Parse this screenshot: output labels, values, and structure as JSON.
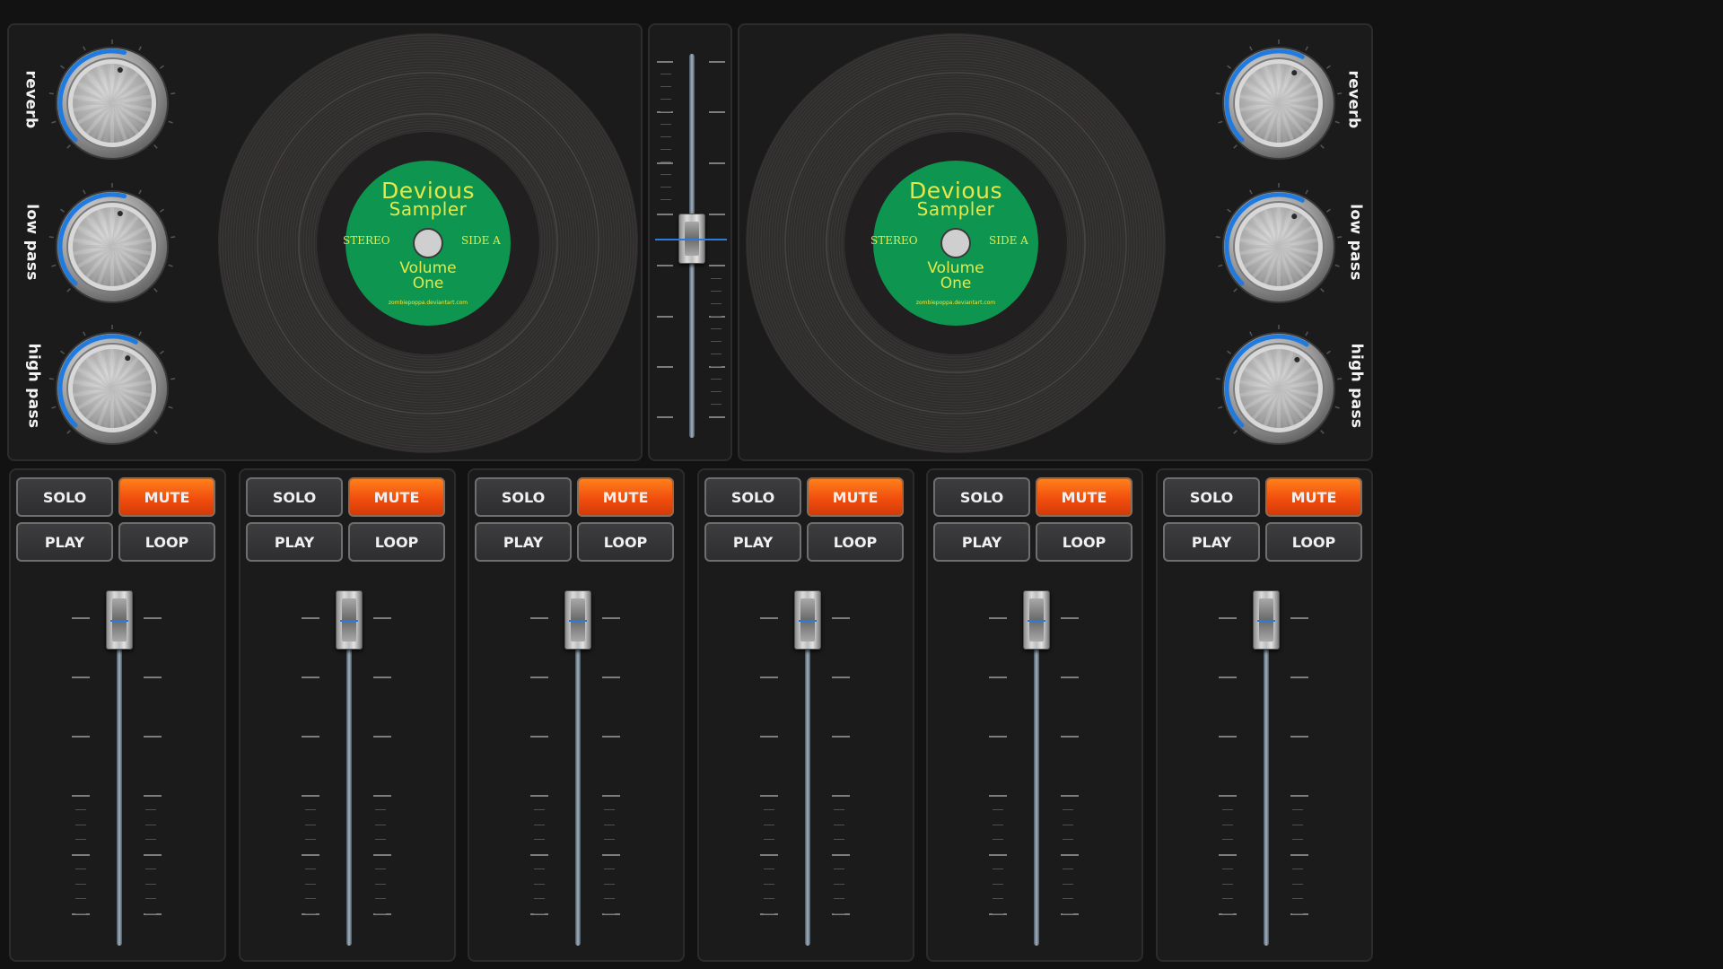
{
  "decks": [
    {
      "id": "left",
      "knobs": [
        {
          "label": "reverb",
          "value": 0.55
        },
        {
          "label": "low pass",
          "value": 0.55
        },
        {
          "label": "high pass",
          "value": 0.6
        }
      ],
      "record": {
        "title": "Devious",
        "subtitle": "Sampler",
        "left_text": "STEREO",
        "right_text": "SIDE A",
        "volume_line1": "Volume",
        "volume_line2": "One",
        "credit": "zombiepoppa.deviantart.com",
        "label_color": "#0e9650",
        "text_color": "#e4e84a"
      }
    },
    {
      "id": "right",
      "knobs": [
        {
          "label": "reverb",
          "value": 0.6
        },
        {
          "label": "low pass",
          "value": 0.6
        },
        {
          "label": "high pass",
          "value": 0.62
        }
      ],
      "record": {
        "title": "Devious",
        "subtitle": "Sampler",
        "left_text": "STEREO",
        "right_text": "SIDE A",
        "volume_line1": "Volume",
        "volume_line2": "One",
        "credit": "zombiepoppa.deviantart.com",
        "label_color": "#0e9650",
        "text_color": "#e4e84a"
      }
    }
  ],
  "crossfader": {
    "position": 0.5
  },
  "channels": [
    {
      "solo": "SOLO",
      "mute": "MUTE",
      "play": "PLAY",
      "loop": "LOOP",
      "fader_level": 1.0
    },
    {
      "solo": "SOLO",
      "mute": "MUTE",
      "play": "PLAY",
      "loop": "LOOP",
      "fader_level": 1.0
    },
    {
      "solo": "SOLO",
      "mute": "MUTE",
      "play": "PLAY",
      "loop": "LOOP",
      "fader_level": 1.0
    },
    {
      "solo": "SOLO",
      "mute": "MUTE",
      "play": "PLAY",
      "loop": "LOOP",
      "fader_level": 1.0
    },
    {
      "solo": "SOLO",
      "mute": "MUTE",
      "play": "PLAY",
      "loop": "LOOP",
      "fader_level": 1.0
    },
    {
      "solo": "SOLO",
      "mute": "MUTE",
      "play": "PLAY",
      "loop": "LOOP",
      "fader_level": 1.0
    }
  ],
  "colors": {
    "mute_active": "#f04e0d",
    "knob_arc": "#1f7be0",
    "fader_marker": "#2b7bd8"
  }
}
